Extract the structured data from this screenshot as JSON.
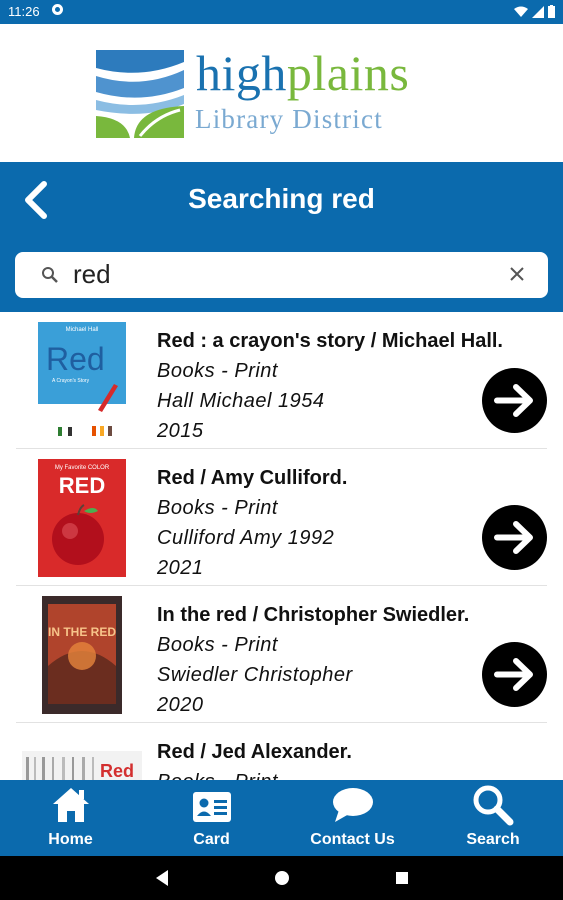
{
  "status_bar": {
    "time": "11:26"
  },
  "logo": {
    "word_high": "high",
    "word_plains": "plains",
    "subtitle": "Library District"
  },
  "header": {
    "title": "Searching red"
  },
  "search": {
    "value": "red"
  },
  "results": [
    {
      "title": "Red : a crayon's story / Michael Hall.",
      "format": "Books - Print",
      "author": "Hall Michael 1954",
      "year": "2015"
    },
    {
      "title": "Red / Amy Culliford.",
      "format": "Books - Print",
      "author": "Culliford Amy 1992",
      "year": "2021"
    },
    {
      "title": "In the red / Christopher Swiedler.",
      "format": "Books - Print",
      "author": "Swiedler Christopher",
      "year": "2020"
    },
    {
      "title": "Red / Jed Alexander.",
      "format": "Books - Print",
      "author": "",
      "year": ""
    }
  ],
  "covers": {
    "c1_title": "Red",
    "c1_author": "Michael Hall",
    "c1_sub": "A Crayon's Story",
    "c2_top": "My Favorite COLOR",
    "c2_title": "RED",
    "c3_title": "IN THE RED",
    "c4_title": "Red"
  },
  "bottom_nav": {
    "home": "Home",
    "card": "Card",
    "contact": "Contact Us",
    "search": "Search"
  },
  "colors": {
    "primary": "#0b6aad",
    "logo_blue": "#1a72b0",
    "logo_green": "#79b83d"
  }
}
